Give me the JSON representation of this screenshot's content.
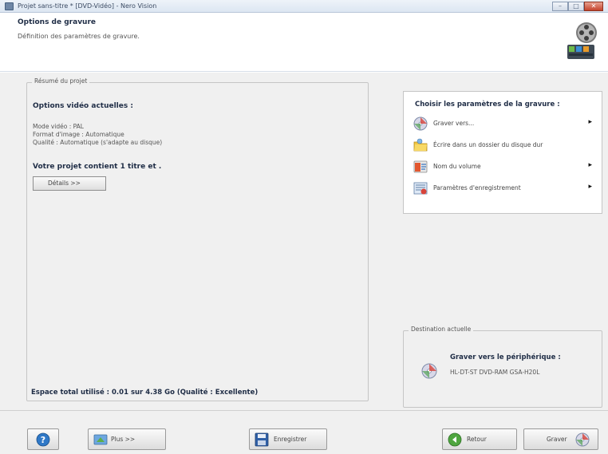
{
  "window": {
    "title": "Projet sans-titre * [DVD-Vidéo] - Nero Vision",
    "controls": {
      "minimize": "–",
      "maximize": "□",
      "close": "✕"
    }
  },
  "header": {
    "title": "Options de gravure",
    "subtitle": "Définition des paramètres de gravure."
  },
  "summary": {
    "legend": "Résumé du projet",
    "heading": "Options vidéo actuelles :",
    "lines": [
      "Mode vidéo : PAL",
      "Format d'image : Automatique",
      "Qualité : Automatique (s'adapte au disque)"
    ],
    "project_contains": "Votre projet contient  1 titre et .",
    "details_button": "Détails >>",
    "total_space": "Espace total utilisé : 0.01 sur 4.38 Go (Qualité : Excellente)"
  },
  "choose": {
    "title": "Choisir les paramètres de la gravure :",
    "items": [
      {
        "label": "Graver vers...",
        "icon": "disc-burn-icon",
        "has_arrow": true
      },
      {
        "label": "Écrire dans un dossier du disque dur",
        "icon": "folder-icon",
        "has_arrow": false
      },
      {
        "label": "Nom du volume",
        "icon": "volume-name-icon",
        "has_arrow": true
      },
      {
        "label": "Paramètres d'enregistrement",
        "icon": "recording-settings-icon",
        "has_arrow": true
      }
    ],
    "arrow_glyph": "▸"
  },
  "destination": {
    "legend": "Destination actuelle",
    "title": "Graver vers le périphérique :",
    "device": "HL-DT-ST DVD-RAM GSA-H20L"
  },
  "footer": {
    "help_icon": "help-icon",
    "more_button": "Plus >>",
    "save_button": "Enregistrer",
    "back_button": "Retour",
    "burn_button": "Graver"
  }
}
